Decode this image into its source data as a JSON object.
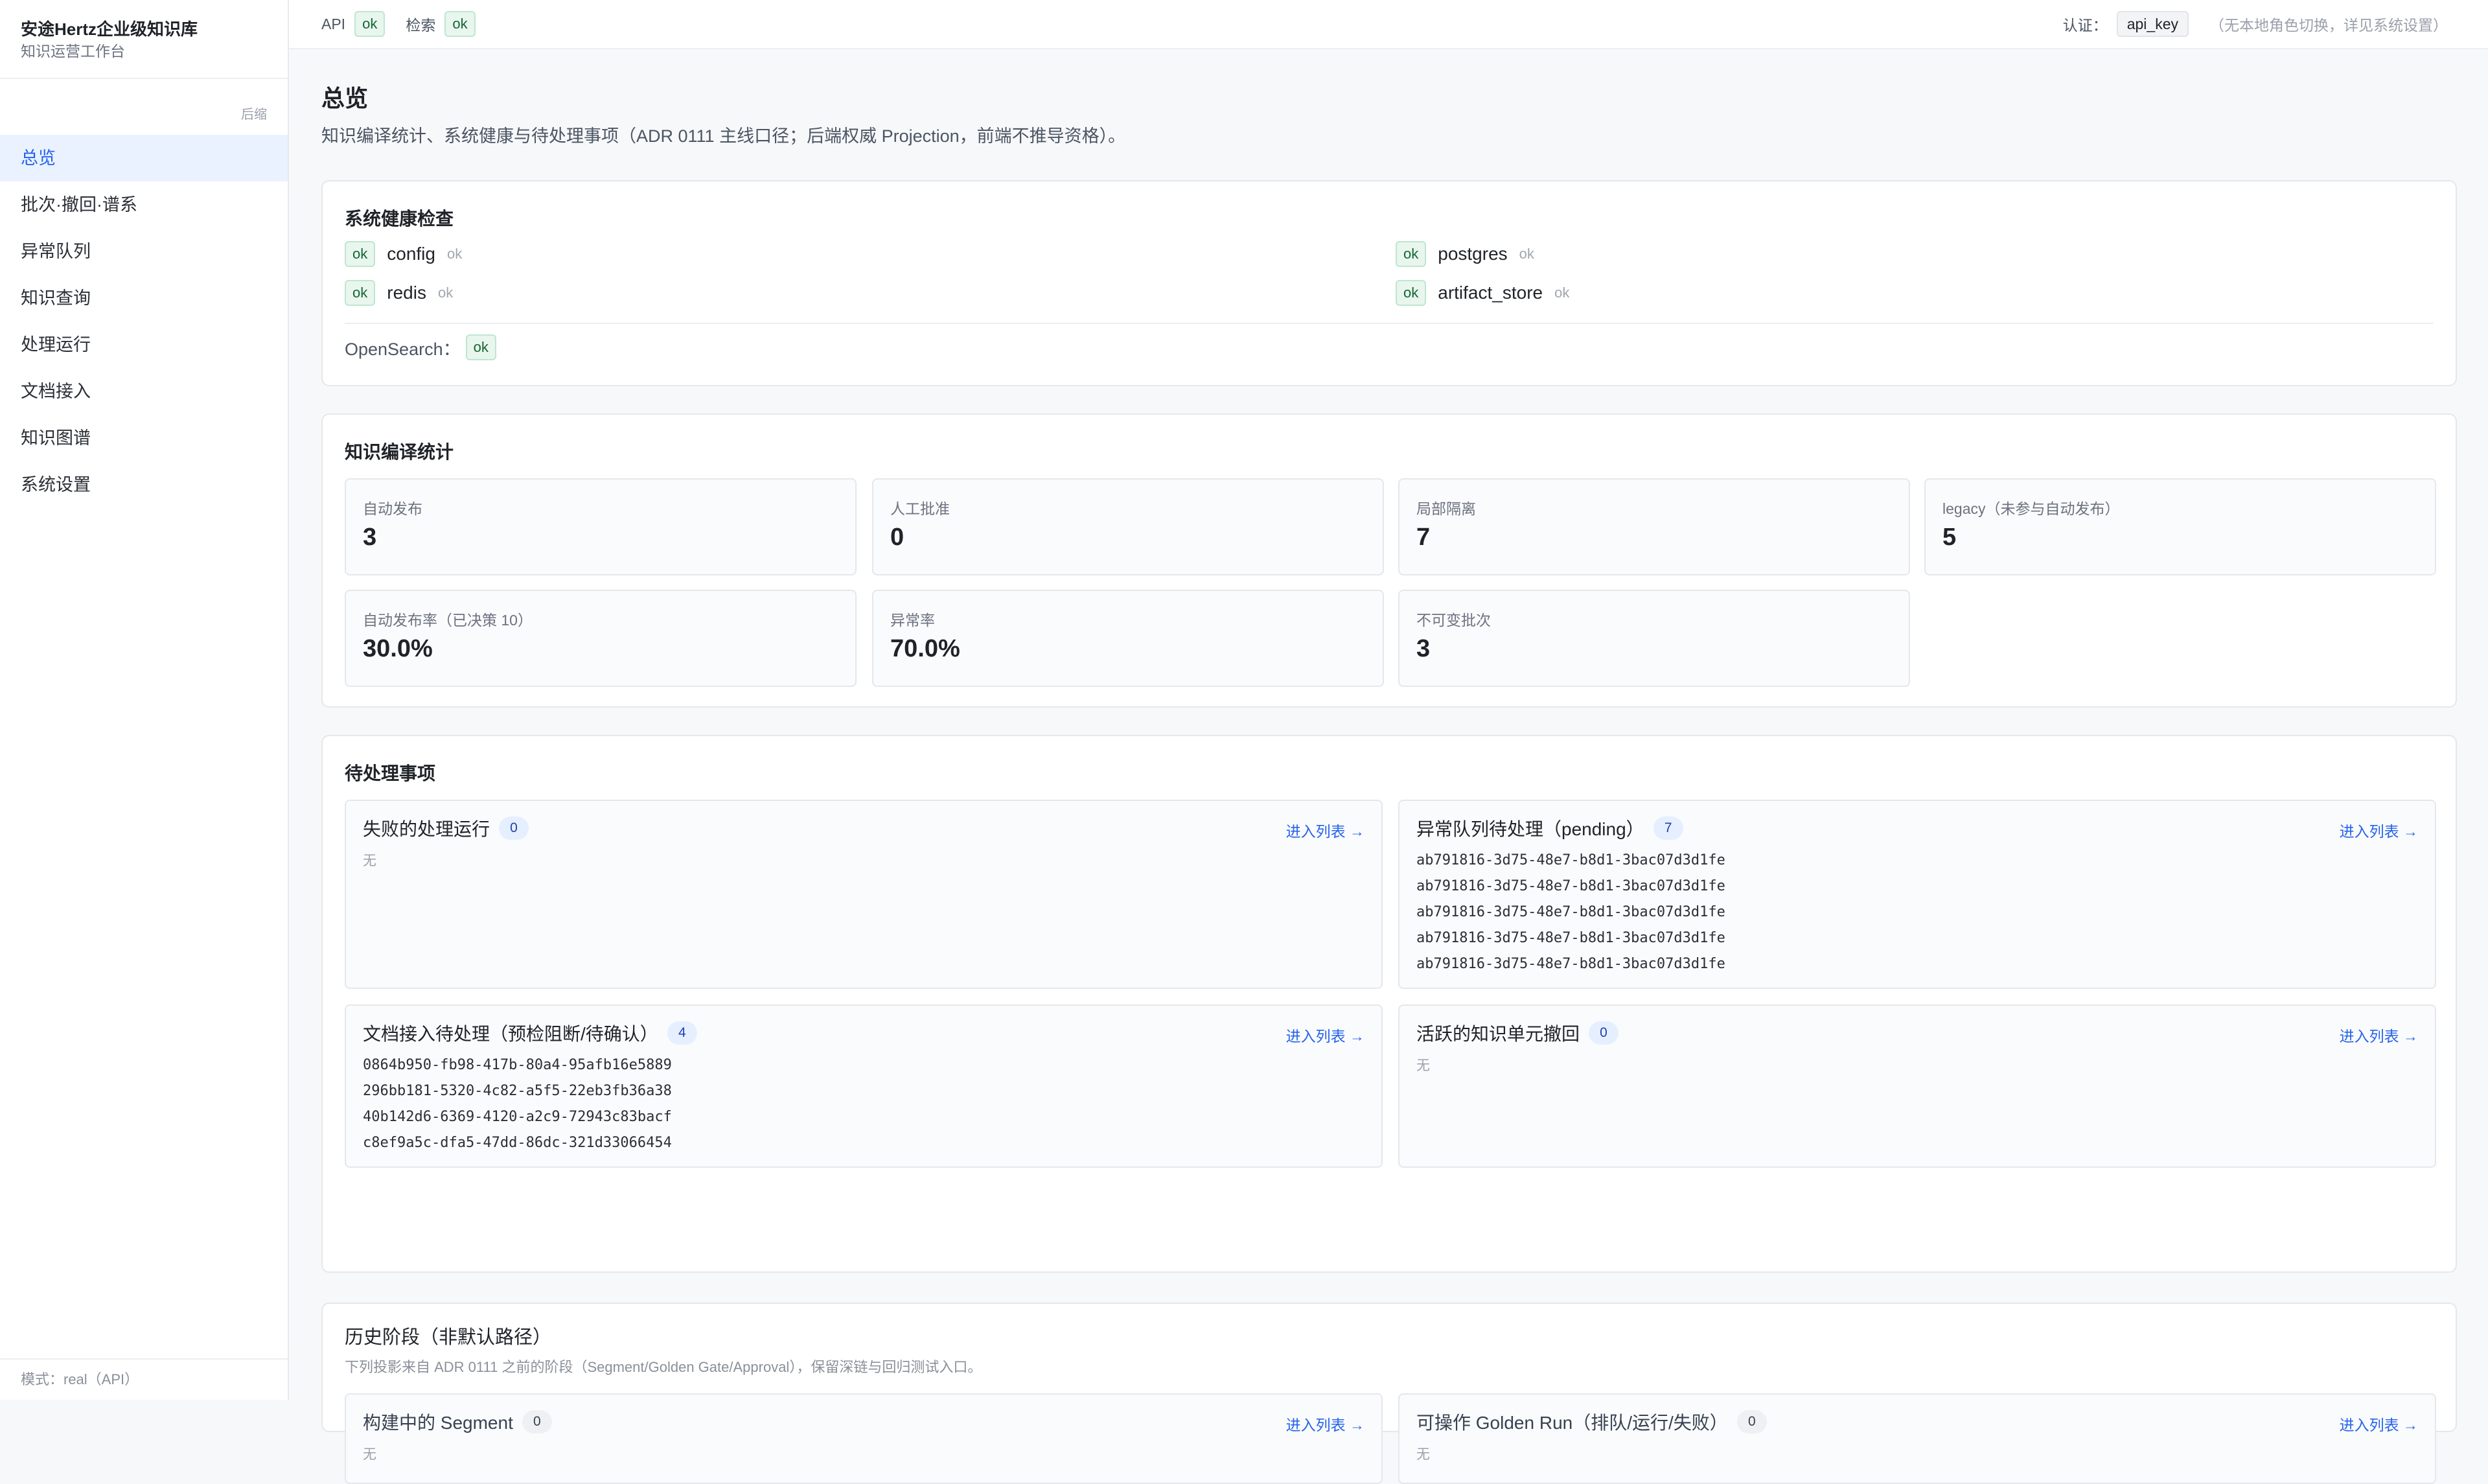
{
  "sidebar": {
    "title": "安途Hertz企业级知识库",
    "subtitle": "知识运营工作台",
    "collapse": "后缩",
    "items": [
      {
        "label": "总览"
      },
      {
        "label": "批次·撤回·谱系"
      },
      {
        "label": "异常队列"
      },
      {
        "label": "知识查询"
      },
      {
        "label": "处理运行"
      },
      {
        "label": "文档接入"
      },
      {
        "label": "知识图谱"
      },
      {
        "label": "系统设置"
      }
    ],
    "footer": "模式：real（API）"
  },
  "topbar": {
    "api_label": "API",
    "api_status": "ok",
    "search_label": "检索",
    "search_status": "ok",
    "auth_label": "认证：",
    "auth_value": "api_key",
    "auth_note": "（无本地角色切换，详见系统设置）"
  },
  "page": {
    "title": "总览",
    "description": "知识编译统计、系统健康与待处理事项（ADR 0111 主线口径；后端权威 Projection，前端不推导资格）。"
  },
  "health": {
    "title": "系统健康检查",
    "items": [
      {
        "status": "ok",
        "name": "config",
        "note": "ok"
      },
      {
        "status": "ok",
        "name": "postgres",
        "note": "ok"
      },
      {
        "status": "ok",
        "name": "redis",
        "note": "ok"
      },
      {
        "status": "ok",
        "name": "artifact_store",
        "note": "ok"
      }
    ],
    "opensearch_label": "OpenSearch：",
    "opensearch_status": "ok"
  },
  "stats": {
    "title": "知识编译统计",
    "items": [
      {
        "label": "自动发布",
        "value": "3"
      },
      {
        "label": "人工批准",
        "value": "0"
      },
      {
        "label": "局部隔离",
        "value": "7"
      },
      {
        "label": "legacy（未参与自动发布）",
        "value": "5"
      },
      {
        "label": "自动发布率（已决策 10）",
        "value": "30.0%"
      },
      {
        "label": "异常率",
        "value": "70.0%"
      },
      {
        "label": "不可变批次",
        "value": "3"
      }
    ]
  },
  "pending": {
    "title": "待处理事项",
    "link_label": "进入列表 →",
    "empty_label": "无",
    "panels": [
      {
        "title": "失败的处理运行",
        "count": "0",
        "items": []
      },
      {
        "title": "异常队列待处理（pending）",
        "count": "7",
        "items": [
          "ab791816-3d75-48e7-b8d1-3bac07d3d1fe",
          "ab791816-3d75-48e7-b8d1-3bac07d3d1fe",
          "ab791816-3d75-48e7-b8d1-3bac07d3d1fe",
          "ab791816-3d75-48e7-b8d1-3bac07d3d1fe",
          "ab791816-3d75-48e7-b8d1-3bac07d3d1fe"
        ]
      },
      {
        "title": "文档接入待处理（预检阻断/待确认）",
        "count": "4",
        "items": [
          "0864b950-fb98-417b-80a4-95afb16e5889",
          "296bb181-5320-4c82-a5f5-22eb3fb36a38",
          "40b142d6-6369-4120-a2c9-72943c83bacf",
          "c8ef9a5c-dfa5-47dd-86dc-321d33066454"
        ]
      },
      {
        "title": "活跃的知识单元撤回",
        "count": "0",
        "items": []
      }
    ]
  },
  "history": {
    "title": "历史阶段（非默认路径）",
    "description": "下列投影来自 ADR 0111 之前的阶段（Segment/Golden Gate/Approval），保留深链与回归测试入口。",
    "panels": [
      {
        "title": "构建中的 Segment",
        "count": "0"
      },
      {
        "title": "可操作 Golden Run（排队/运行/失败）",
        "count": "0"
      }
    ]
  }
}
